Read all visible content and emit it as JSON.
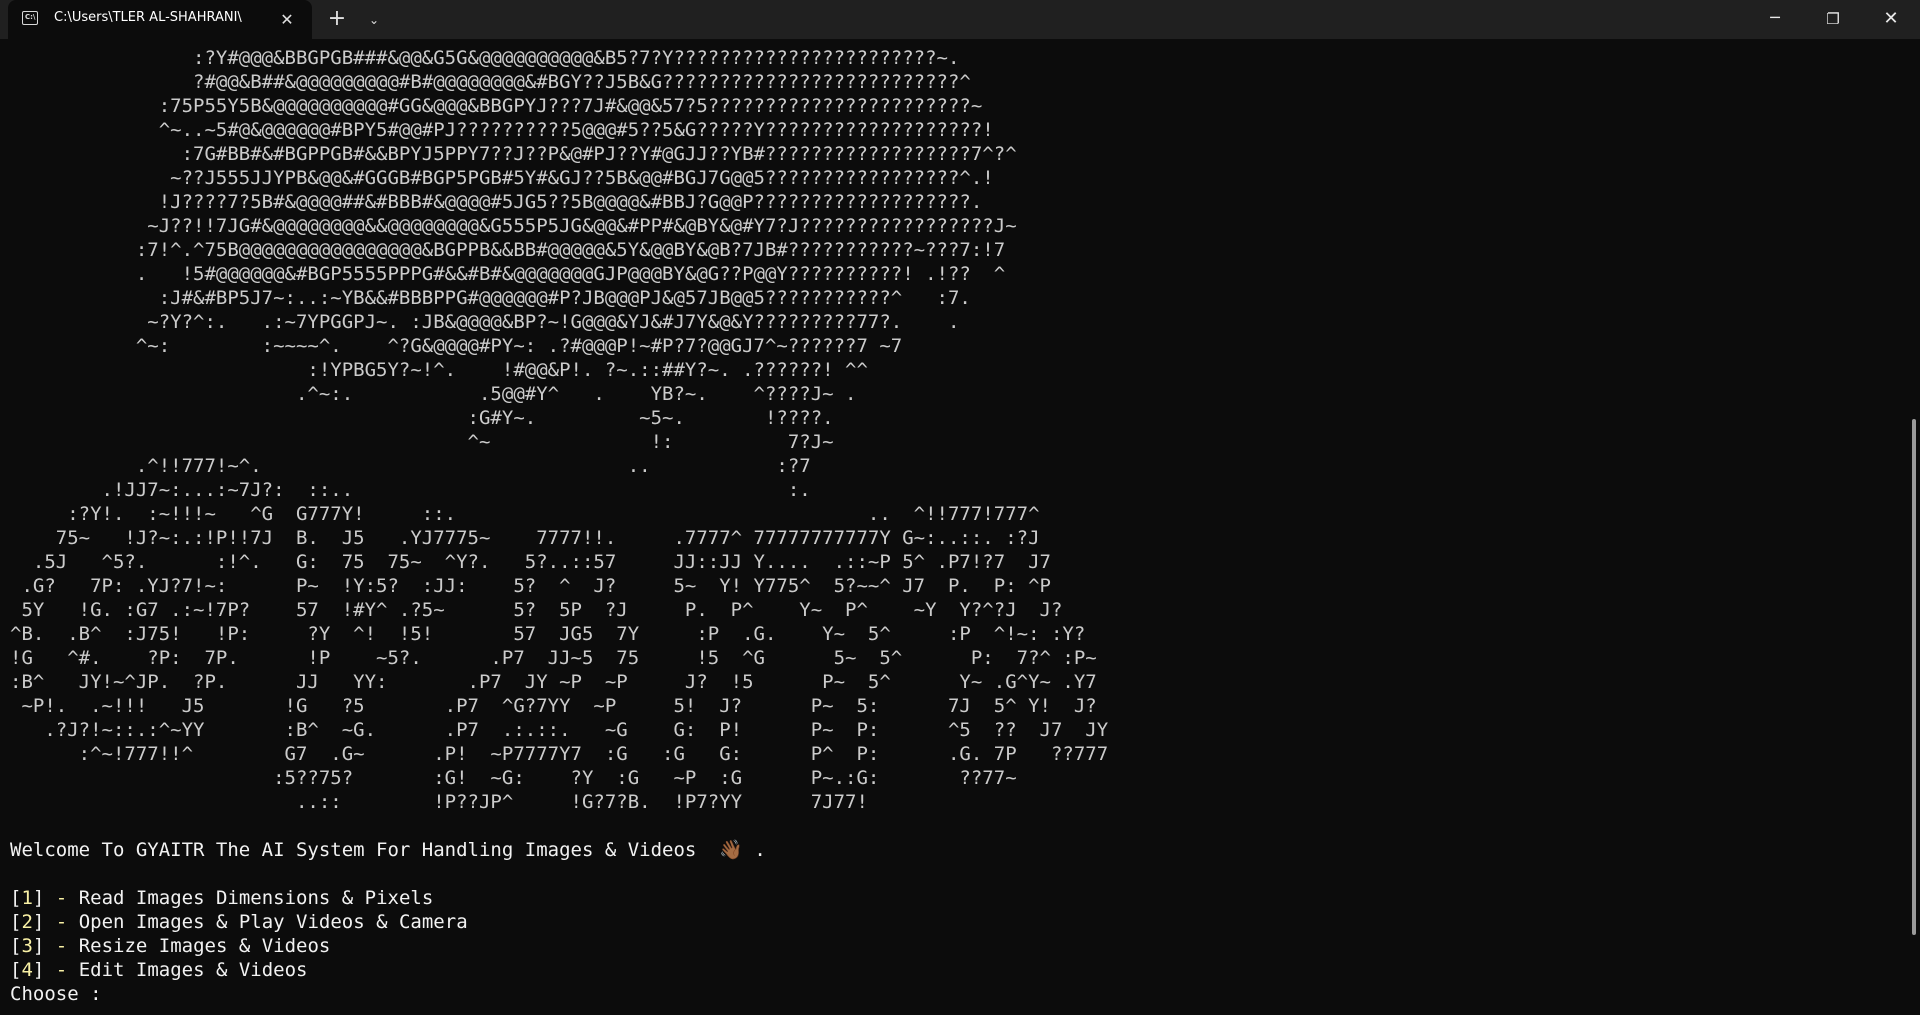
{
  "window": {
    "tab_title": "C:\\Users\\TLER AL-SHAHRANI\\",
    "tab_close_glyph": "✕",
    "new_tab_glyph": "+",
    "tab_dropdown_glyph": "⌄",
    "minimize_glyph": "─",
    "maximize_glyph": "❐",
    "close_glyph": "✕"
  },
  "terminal": {
    "ascii_art": [
      "                :?Y#@@@&BBGPGB###&@@&G5G&@@@@@@@@@@&B5?7?Y???????????????????????~.",
      "                ?#@@&B##&@@@@@@@@@#B#@@@@@@@@&#BGY??J5B&G??????????????????????????^",
      "             :75P55Y5B&@@@@@@@@@@#GG&@@@&BBGPYJ???7J#&@@&57?5???????????????????????~",
      "             ^~..~5#@&@@@@@@#BPY5#@@#PJ??????????5@@@#5??5&G?????Y???????????????????!",
      "               :7G#BB#&#BGPPGB#&&BPYJ5PPY7??J??P&@#PJ??Y#@GJJ??YB#??????????????????7^?^",
      "              ~??J555JJYPB&@@&#GGGB#BGP5PGB#5Y#&GJ??5B&@@#BGJ7G@@5?????????????????^.!",
      "             !J????7?5B#&@@@@##&#BBB#&@@@@#5JG5??5B@@@@&#BBJ?G@@P???????????????????.",
      "            ~J??!!7JG#&@@@@@@@@&&@@@@@@@@&G555P5JG&@@&#PP#&@BY&@#Y7?J?????????????????J~",
      "           :7!^.^75B@@@@@@@@@@@@@@@@&BGPPB&&BB#@@@@@&5Y&@@BY&@B?7JB#???????????~???7:!7",
      "           .   !5#@@@@@@&#BGP5555PPPG#&&#B#&@@@@@@@GJP@@@BY&@G??P@@Y??????????! .!??  ^",
      "             :J#&#BP5J7~:..:~YB&&#BBBPPG#@@@@@@#P?JB@@@PJ&@57JB@@5???????????^   :7.",
      "            ~?Y?^:.   .:~7YPGGPJ~. :JB&@@@@&BP?~!G@@@&YJ&#J7Y&@&Y?????????77?.    .",
      "           ^~:        :~~~~^.    ^?G&@@@@#PY~: .?#@@@P!~#P?7?@@GJ7^~??????7 ~7",
      "                          :!YPBG5Y?~!^.    !#@@&P!. ?~.::##Y?~. .??????! ^^",
      "                         .^~:.           .5@@#Y^   .    YB?~.    ^????J~ .",
      "                                        :G#Y~.         ~5~.       !????.",
      "                                        ^~              !:          7?J~",
      "           .^!!777!~^.                                ..           :?7",
      "        .!JJ7~:...:~7J?:  ::..                                      :.",
      "     :?Y!.  :~!!!~   ^G  G777Y!     ::.                                    ..  ^!!777!777^",
      "    75~   !J?~:.:!P!!7J  B.  J5   .YJ7775~    7777!!.     .7777^ 77777777777Y G~:..::. :?J",
      "  .5J   ^5?.      :!^.   G:  75  75~  ^Y?.   5?..::57     JJ::JJ Y....  .::~P 5^ .P7!?7  J7",
      " .G?   7P: .YJ?7!~:      P~  !Y:5?  :JJ:    5?  ^  J?     5~  Y! Y775^  5?~~^ J7  P.  P: ^P",
      " 5Y   !G. :G7 .:~!7P?    57  !#Y^ .?5~      5?  5P  ?J     P.  P^    Y~  P^    ~Y  Y?^?J  J?",
      "^B.  .B^  :J75!   !P:     ?Y  ^!  !5!       57  JG5  7Y     :P  .G.    Y~  5^     :P  ^!~: :Y?",
      "!G   ^#.    ?P:  7P.      !P    ~5?.      .P7  JJ~5  75     !5  ^G      5~  5^      P:  7?^ :P~",
      ":B^   JY!~^JP.  ?P.      JJ   YY:       .P7  JY ~P  ~P     J?  !5      P~  5^      Y~ .G^Y~ .Y7",
      " ~P!.  .~!!!   J5       !G   ?5       .P7  ^G?7YY  ~P     5!  J?      P~  5:      7J  5^ Y!  J?",
      "   .?J?!~::.:^~YY       :B^  ~G.      .P7  .:.::.   ~G    G:  P!      P~  P:      ^5  ??  J7  JY",
      "      :^~!777!!^        G7  .G~      .P!  ~P7777Y7  :G   :G   G:      P^  P:      .G. 7P   ??777",
      "                       :5??75?       :G!  ~G:    ?Y  :G   ~P  :G      P~.:G:       ??77~",
      "                         ..::        !P??JP^     !G?7?B.  !P7?YY      7J77!"
    ],
    "welcome_text": "Welcome To GYAITR The AI System For Handling Images & Videos",
    "welcome_emoji": "👋🏾",
    "welcome_suffix": ".",
    "menu": [
      {
        "num": "1",
        "label": "Read Images Dimensions & Pixels"
      },
      {
        "num": "2",
        "label": "Open Images & Play Videos & Camera"
      },
      {
        "num": "3",
        "label": "Resize Images & Videos"
      },
      {
        "num": "4",
        "label": "Edit Images & Videos"
      }
    ],
    "prompt": "Choose :"
  },
  "colors": {
    "background": "#0c0c0c",
    "titlebar": "#202020",
    "text": "#cccccc",
    "menu_number": "#f9f1a5"
  }
}
